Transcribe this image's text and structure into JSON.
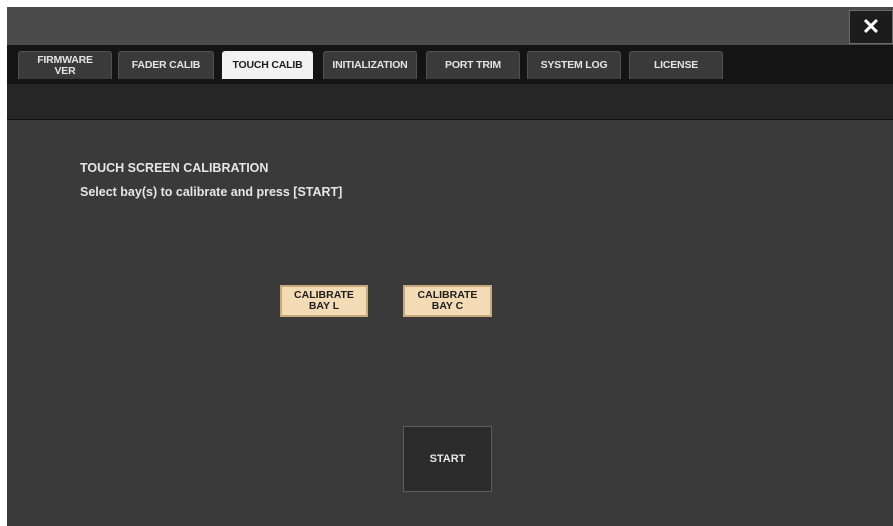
{
  "window": {
    "close_icon": "close-icon",
    "close_glyph": "✕"
  },
  "tabs": [
    {
      "label": "FIRMWARE\nVER",
      "active": false
    },
    {
      "label": "FADER CALIB",
      "active": false
    },
    {
      "label": "TOUCH CALIB",
      "active": true
    },
    {
      "label": "INITIALIZATION",
      "active": false
    },
    {
      "label": "PORT TRIM",
      "active": false
    },
    {
      "label": "SYSTEM LOG",
      "active": false
    },
    {
      "label": "LICENSE",
      "active": false
    }
  ],
  "main": {
    "heading": "TOUCH SCREEN CALIBRATION",
    "instruction": "Select bay(s) to calibrate and press [START]",
    "calibrate_bay_l": "CALIBRATE\nBAY L",
    "calibrate_bay_c": "CALIBRATE\nBAY C",
    "start_label": "START"
  },
  "colors": {
    "panel_background": "#3a3a3a",
    "tab_bar": "#141414",
    "active_tab": "#f2f2f2",
    "calibrate_button": "#f3dcb5"
  }
}
